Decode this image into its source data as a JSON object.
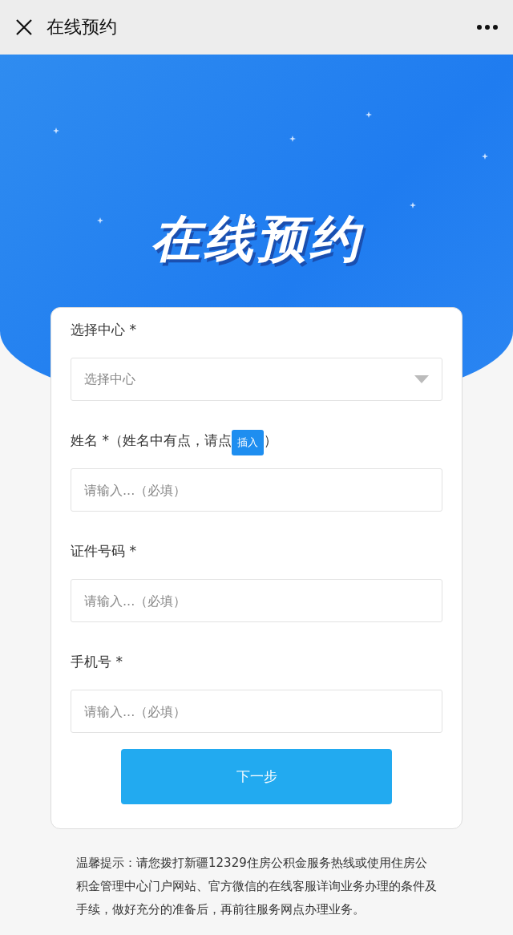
{
  "top_bar": {
    "title": "在线预约"
  },
  "hero": {
    "title": "在线预约"
  },
  "form": {
    "fields": [
      {
        "kind": "select",
        "label": "选择中心 *",
        "placeholder": "选择中心"
      },
      {
        "kind": "text",
        "label": "姓名 *（姓名中有点，请点",
        "insert_button": "插入",
        "label_end": "）",
        "placeholder": "请输入...（必填）"
      },
      {
        "kind": "text",
        "label": "证件号码 *",
        "placeholder": "请输入...（必填）"
      },
      {
        "kind": "text",
        "label": "手机号 *",
        "placeholder": "请输入...（必填）"
      }
    ],
    "next_button": "下一步"
  },
  "notice": "温馨提示：请您拨打新疆12329住房公积金服务热线或使用住房公积金管理中心门户网站、官方微信的在线客服详询业务办理的条件及手续，做好充分的准备后，再前往服务网点办理业务。"
}
